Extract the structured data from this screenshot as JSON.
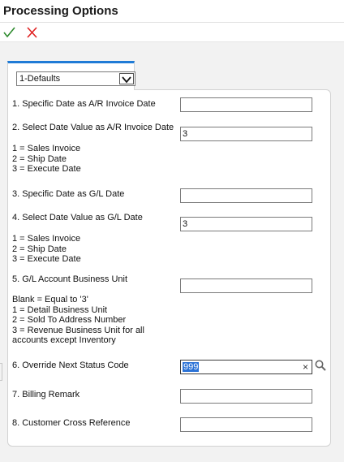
{
  "header": {
    "title": "Processing Options"
  },
  "toolbar": {
    "ok_icon": "checkmark-icon",
    "cancel_icon": "close-icon"
  },
  "tab": {
    "selected": "1-Defaults"
  },
  "options": [
    {
      "label": "1. Specific Date as A/R Invoice Date",
      "value": ""
    },
    {
      "label": "2. Select Date Value as A/R Invoice Date",
      "value": "3",
      "notes": [
        "1 = Sales Invoice",
        "2 = Ship Date",
        "3 = Execute Date"
      ]
    },
    {
      "label": "3. Specific Date as G/L Date",
      "value": ""
    },
    {
      "label": "4. Select Date Value as G/L Date",
      "value": "3",
      "notes": [
        "1 = Sales Invoice",
        "2 = Ship Date",
        "3 = Execute Date"
      ]
    },
    {
      "label": "5. G/L Account Business Unit",
      "value": "",
      "notes": [
        "Blank = Equal to '3'",
        "1 = Detail Business Unit",
        "2 = Sold To Address Number",
        "3 = Revenue Business Unit for all",
        "accounts except Inventory"
      ]
    },
    {
      "label": "6. Override Next Status Code",
      "value": "999"
    },
    {
      "label": "7. Billing Remark",
      "value": ""
    },
    {
      "label": "8. Customer Cross Reference",
      "value": ""
    }
  ],
  "colors": {
    "accent": "#1f7bd6",
    "ok": "#2e8b2e",
    "cancel": "#e02020",
    "selection": "#2b72d6"
  }
}
